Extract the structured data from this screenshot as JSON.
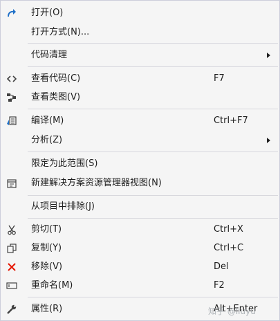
{
  "menu": {
    "open": {
      "label": "打开(O)",
      "icon": "redo-arrow-icon"
    },
    "open_with": {
      "label": "打开方式(N)..."
    },
    "code_cleanup": {
      "label": "代码清理",
      "has_submenu": true
    },
    "view_code": {
      "label": "查看代码(C)",
      "shortcut": "F7",
      "icon": "code-brackets-icon"
    },
    "view_class_diagram": {
      "label": "查看类图(V)",
      "icon": "class-diagram-icon"
    },
    "compile": {
      "label": "编译(M)",
      "shortcut": "Ctrl+F7",
      "icon": "compile-icon"
    },
    "analyze": {
      "label": "分析(Z)",
      "has_submenu": true
    },
    "scope_to_this": {
      "label": "限定为此范围(S)"
    },
    "new_solution_explorer_view": {
      "label": "新建解决方案资源管理器视图(N)",
      "icon": "new-view-icon"
    },
    "exclude_from_project": {
      "label": "从项目中排除(J)"
    },
    "cut": {
      "label": "剪切(T)",
      "shortcut": "Ctrl+X",
      "icon": "scissors-icon"
    },
    "copy": {
      "label": "复制(Y)",
      "shortcut": "Ctrl+C",
      "icon": "copy-icon"
    },
    "remove": {
      "label": "移除(V)",
      "shortcut": "Del",
      "icon": "red-x-icon"
    },
    "rename": {
      "label": "重命名(M)",
      "shortcut": "F2",
      "icon": "rename-icon"
    },
    "properties": {
      "label": "属性(R)",
      "shortcut": "Alt+Enter",
      "icon": "wrench-icon"
    }
  },
  "watermark": "知乎 @liuyu",
  "colors": {
    "accent_blue": "#1e6fc7",
    "remove_red": "#e51400",
    "icon_gray": "#424242"
  }
}
